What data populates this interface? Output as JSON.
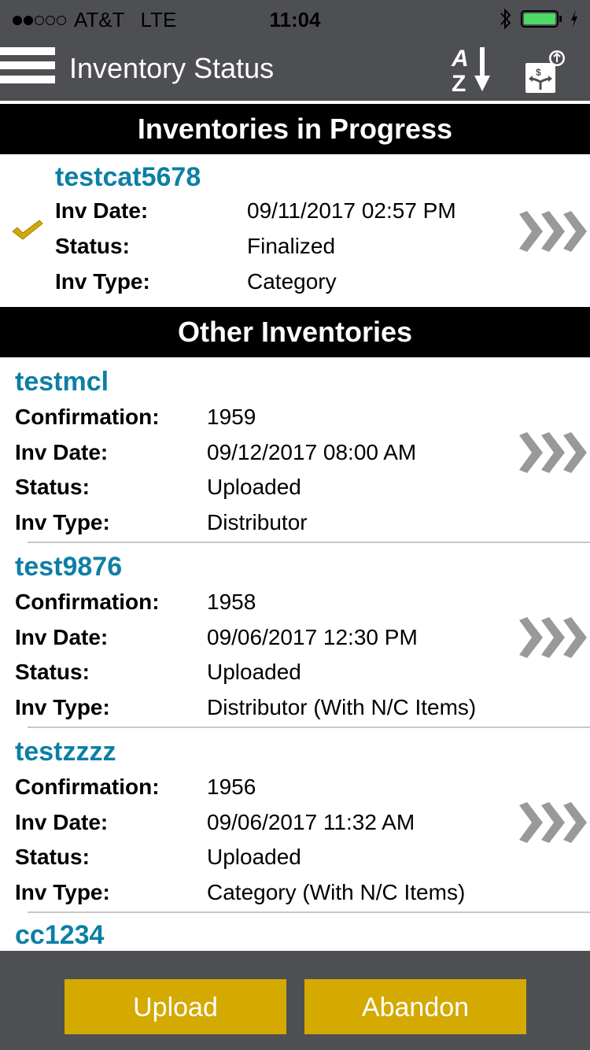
{
  "status_bar": {
    "signal_strength": "2 of 5",
    "carrier": "AT&T",
    "network": "LTE",
    "time": "11:04",
    "bluetooth_icon": "bluetooth-icon",
    "battery_level": "100%",
    "charging_icon": "bolt-icon"
  },
  "nav": {
    "title": "Inventory Status",
    "menu_icon": "hamburger-icon",
    "sort_icon": "sort-az-icon",
    "upload_icon": "upload-costing-icon"
  },
  "sections": {
    "in_progress": "Inventories in Progress",
    "other": "Other Inventories"
  },
  "labels": {
    "confirmation": "Confirmation:",
    "inv_date": "Inv Date:",
    "status": "Status:",
    "inv_type": "Inv Type:"
  },
  "in_progress": [
    {
      "name": "testcat5678",
      "inv_date": "09/11/2017  02:57 PM",
      "status": "Finalized",
      "inv_type": "Category",
      "selected": true
    }
  ],
  "other": [
    {
      "name": "testmcl",
      "confirmation": "1959",
      "inv_date": "09/12/2017  08:00 AM",
      "status": "Uploaded",
      "inv_type": "Distributor"
    },
    {
      "name": "test9876",
      "confirmation": "1958",
      "inv_date": "09/06/2017  12:30 PM",
      "status": "Uploaded",
      "inv_type": "Distributor (With N/C Items)"
    },
    {
      "name": "testzzzz",
      "confirmation": "1956",
      "inv_date": "09/06/2017  11:32 AM",
      "status": "Uploaded",
      "inv_type": "Category (With N/C Items)"
    },
    {
      "name": "cc1234"
    }
  ],
  "buttons": {
    "upload": "Upload",
    "abandon": "Abandon"
  },
  "colors": {
    "accent": "#d4a900",
    "title_blue": "#0d7fa5",
    "bar_gray": "#4e4f53",
    "chevron_gray": "#999999"
  }
}
